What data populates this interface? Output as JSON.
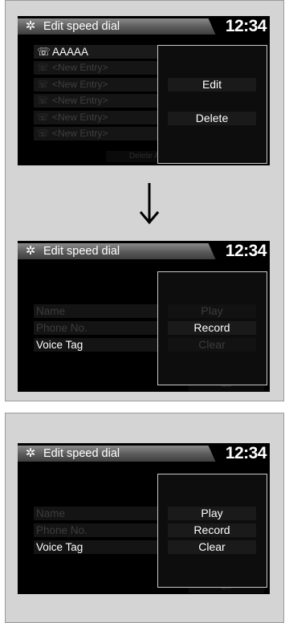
{
  "header": {
    "title": "Edit speed dial",
    "clock": "12:34"
  },
  "screen1": {
    "entries": [
      {
        "label": "AAAAA",
        "active": true
      },
      {
        "label": "<New Entry>",
        "active": false
      },
      {
        "label": "<New Entry>",
        "active": false
      },
      {
        "label": "<New Entry>",
        "active": false
      },
      {
        "label": "<New Entry>",
        "active": false
      },
      {
        "label": "<New Entry>",
        "active": false
      }
    ],
    "delete_all": "Delete All",
    "menu": [
      "Edit",
      "Delete"
    ]
  },
  "screen2": {
    "fields": [
      "Name",
      "Phone No.",
      "Voice Tag"
    ],
    "menu": [
      "Play",
      "Record",
      "Clear"
    ],
    "bottom_dim": "Off"
  },
  "screen3": {
    "fields": [
      "Name",
      "Phone No.",
      "Voice Tag"
    ],
    "menu": [
      "Play",
      "Record",
      "Clear"
    ],
    "bottom_dim": "Off"
  },
  "icons": {
    "settings": "gear-icon",
    "phone": "phone-icon",
    "arrow": "down-arrow-icon"
  }
}
